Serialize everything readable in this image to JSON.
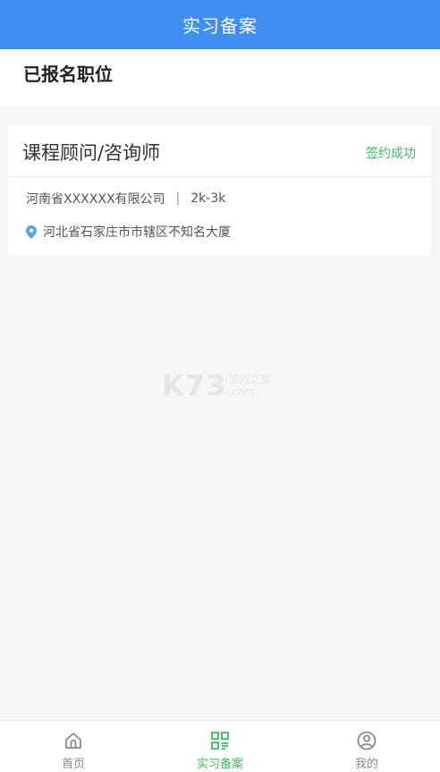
{
  "header": {
    "title": "实习备案"
  },
  "section": {
    "title": "已报名职位"
  },
  "job": {
    "title": "课程顾问/咨询师",
    "status": "签约成功",
    "company": "河南省XXXXXX有限公司",
    "separator": "|",
    "salary": "2k-3k",
    "address": "河北省石家庄市市辖区不知名大厦"
  },
  "watermark": {
    "logo": "K73",
    "text": "游戏之家",
    "domain": ".com"
  },
  "tabs": [
    {
      "label": "首页",
      "icon": "home-icon"
    },
    {
      "label": "实习备案",
      "icon": "qrcode-icon",
      "active": true
    },
    {
      "label": "我的",
      "icon": "user-icon"
    }
  ],
  "colors": {
    "header": "#3f8ef3",
    "active": "#3cbf5a",
    "status": "#3cbf5a"
  }
}
